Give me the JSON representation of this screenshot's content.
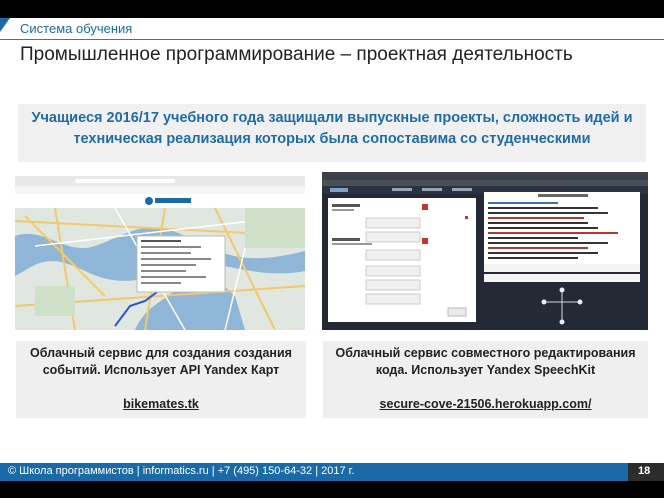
{
  "header": {
    "kicker": "Система обучения",
    "title": "Промышленное программирование – проектная деятельность"
  },
  "banner": {
    "text": "Учащиеся 2016/17 учебного года защищали выпускные проекты, сложность идей и техническая реализация которых была сопоставима со студенческими"
  },
  "projects": [
    {
      "description": "Облачный сервис для создания создания событий. Использует API Yandex Карт",
      "link": "bikemates.tk"
    },
    {
      "description": "Облачный сервис совместного редактирования кода. Использует Yandex SpeechKit",
      "link": "secure-cove-21506.herokuapp.com/"
    }
  ],
  "footer": {
    "text": "© Школа программистов  |  informatics.ru  |  +7 (495) 150-64-32  |  2017 г.",
    "page_number": "18"
  },
  "colors": {
    "accent": "#1a6aa8",
    "banner_text": "#1f6ca9",
    "map_land": "#dfe7e0",
    "map_water": "#8fb6d6",
    "editor_bg": "#232a35"
  }
}
